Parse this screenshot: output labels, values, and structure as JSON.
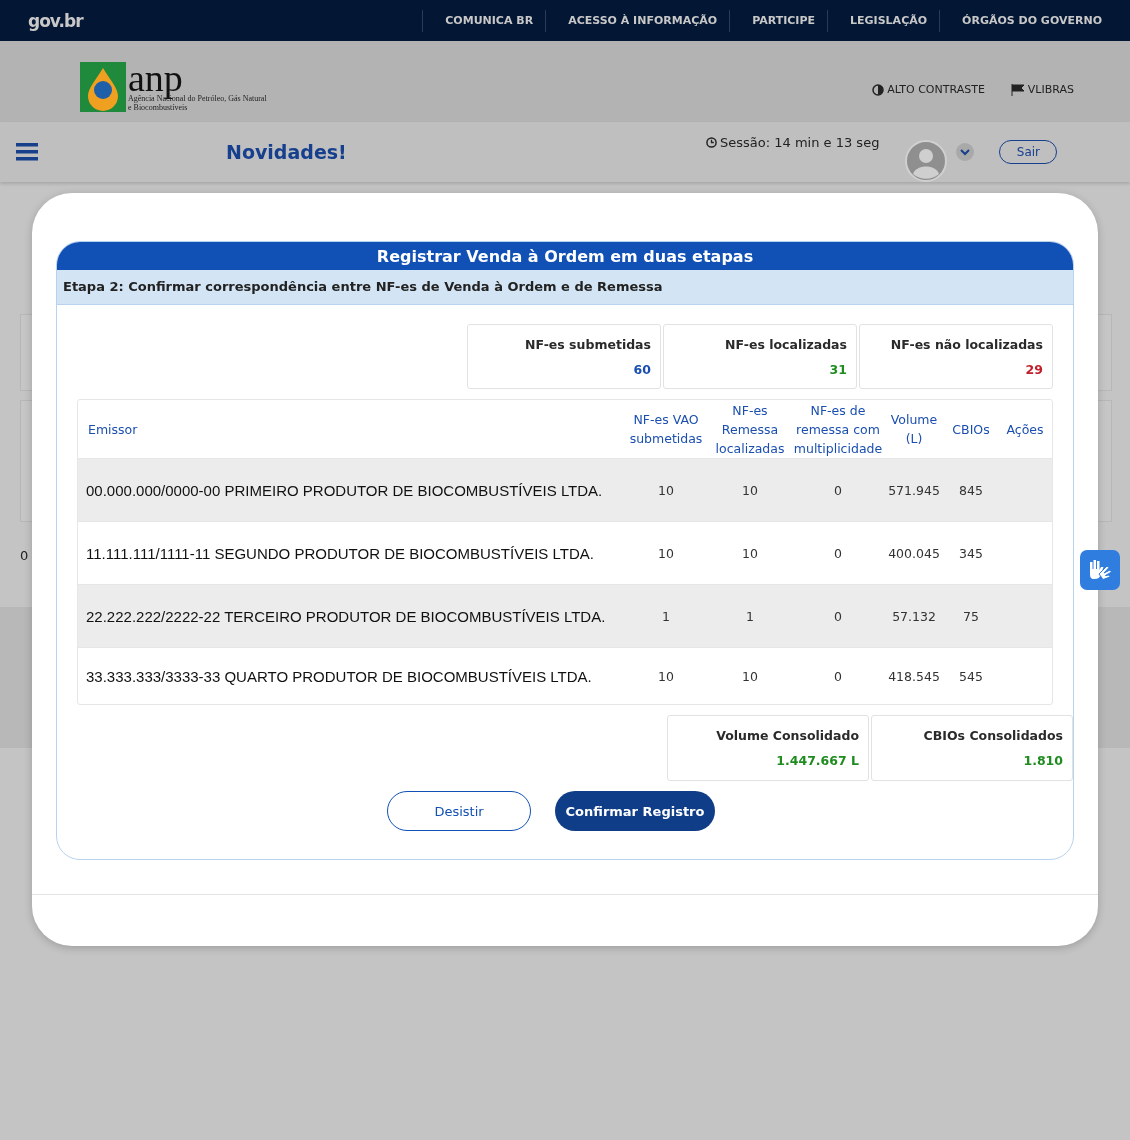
{
  "gov_bar": {
    "logo": "gov.br",
    "links": [
      "COMUNICA BR",
      "ACESSO À INFORMAÇÃO",
      "PARTICIPE",
      "LEGISLAÇÃO",
      "ÓRGÃOS DO GOVERNO"
    ]
  },
  "header": {
    "logo_text": "anp",
    "logo_subtitle": "Agência Nacional do Petróleo, Gás Natural e Biocombustíveis",
    "high_contrast": "ALTO CONTRASTE",
    "vlibras": "VLIBRAS"
  },
  "nav": {
    "title": "Novidades!",
    "session": "Sessão: 14 min e 13 seg",
    "logout": "Sair"
  },
  "page_fragments": {
    "count": "0"
  },
  "modal": {
    "title": "Registrar Venda à Ordem em duas etapas",
    "step": "Etapa 2: Confirmar correspondência entre NF-es de Venda à Ordem e de Remessa",
    "summary": [
      {
        "label": "NF-es submetidas",
        "value": "60",
        "color": "#1a4fb0"
      },
      {
        "label": "NF-es localizadas",
        "value": "31",
        "color": "#1e8c1e"
      },
      {
        "label": "NF-es não localizadas",
        "value": "29",
        "color": "#c0202a"
      }
    ],
    "table": {
      "columns": [
        "Emissor",
        "NF-es VAO submetidas",
        "NF-es Remessa localizadas",
        "NF-es de remessa com multiplicidade",
        "Volume (L)",
        "CBIOs",
        "Ações"
      ],
      "rows": [
        [
          "00.000.000/0000-00 PRIMEIRO PRODUTOR DE BIOCOMBUSTÍVEIS LTDA.",
          "10",
          "10",
          "0",
          "571.945",
          "845"
        ],
        [
          "11.111.111/1111-11 SEGUNDO PRODUTOR DE BIOCOMBUSTÍVEIS LTDA.",
          "10",
          "10",
          "0",
          "400.045",
          "345"
        ],
        [
          "22.222.222/2222-22 TERCEIRO PRODUTOR DE BIOCOMBUSTÍVEIS LTDA.",
          "1",
          "1",
          "0",
          "57.132",
          "75"
        ],
        [
          "33.333.333/3333-33 QUARTO PRODUTOR DE BIOCOMBUSTÍVEIS LTDA.",
          "10",
          "10",
          "0",
          "418.545",
          "545"
        ]
      ]
    },
    "totals": [
      {
        "label": "Volume Consolidado",
        "value": "1.447.667 L"
      },
      {
        "label": "CBIOs Consolidados",
        "value": "1.810"
      }
    ],
    "buttons": {
      "cancel": "Desistir",
      "confirm": "Confirmar Registro"
    }
  }
}
